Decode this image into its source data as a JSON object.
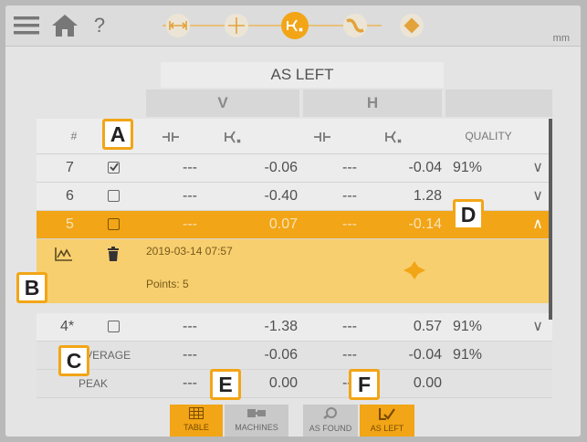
{
  "toolbar": {
    "menu_icon": "menu-icon",
    "home_icon": "home-icon",
    "help_label": "?",
    "unit": "mm",
    "steps": [
      "dimensions-step",
      "target-step",
      "as-left-step",
      "measure-step",
      "tag-step"
    ]
  },
  "title": "AS LEFT",
  "groups": {
    "v": "V",
    "h": "H"
  },
  "header": {
    "num": "#",
    "quality": "QUALITY"
  },
  "rows": [
    {
      "num": "7",
      "checked": true,
      "v1": "---",
      "v2": "-0.06",
      "h1": "---",
      "h2": "-0.04",
      "quality": "91%",
      "chevron": "∨"
    },
    {
      "num": "6",
      "checked": false,
      "v1": "---",
      "v2": "-0.40",
      "h1": "---",
      "h2": "1.28",
      "quality": "",
      "chevron": "∨"
    },
    {
      "num": "5",
      "checked": false,
      "v1": "---",
      "v2": "0.07",
      "h1": "---",
      "h2": "-0.14",
      "quality": "91%",
      "chevron": "∧"
    },
    {
      "num": "4*",
      "checked": false,
      "v1": "---",
      "v2": "-1.38",
      "h1": "---",
      "h2": "0.57",
      "quality": "91%",
      "chevron": "∨"
    }
  ],
  "detail": {
    "timestamp": "2019-03-14 07:57",
    "points": "Points: 5"
  },
  "average": {
    "label": "AVERAGE",
    "v1": "---",
    "v2": "-0.06",
    "h1": "---",
    "h2": "-0.04",
    "quality": "91%"
  },
  "peak": {
    "label": "PEAK",
    "v1": "---",
    "v2": "0.00",
    "h1": "---",
    "h2": "0.00"
  },
  "callouts": [
    "A",
    "B",
    "C",
    "D",
    "E",
    "F"
  ],
  "bottom_tabs": [
    {
      "label": "TABLE",
      "active": true
    },
    {
      "label": "MACHINES",
      "active": false
    },
    {
      "label": "AS FOUND",
      "active": false
    },
    {
      "label": "AS LEFT",
      "active": true
    }
  ],
  "colors": {
    "accent": "#f2a516",
    "detail": "#f7cf6f"
  }
}
